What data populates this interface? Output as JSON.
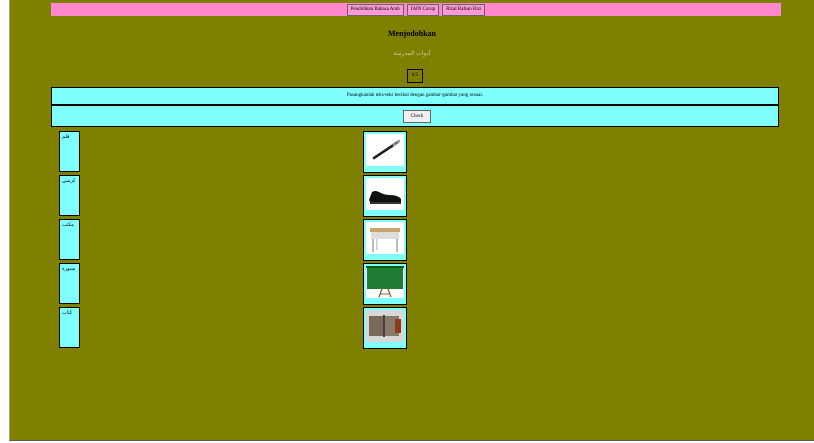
{
  "nav": {
    "items": [
      "Pendidikan Bahasa Arab",
      "IAIN Curup",
      "Rizal Rafsan Rizi"
    ]
  },
  "title": "Menjodohkan",
  "subtitle": "أدوات المدرسة",
  "counter": "0/5",
  "instruction": "Pasangkanlah teks-teks berikut dengan gambar-gambar yang sesuai.",
  "check_label": "Check",
  "words": [
    "قلم",
    "كرسي",
    "مكتب",
    "سبورة",
    "كتاب"
  ],
  "pictures": [
    "pen-image",
    "shoe-image",
    "desk-image",
    "blackboard-image",
    "book-image"
  ],
  "colors": {
    "background": "#808000",
    "nav": "#ff88cc",
    "panel": "#80ffff"
  }
}
